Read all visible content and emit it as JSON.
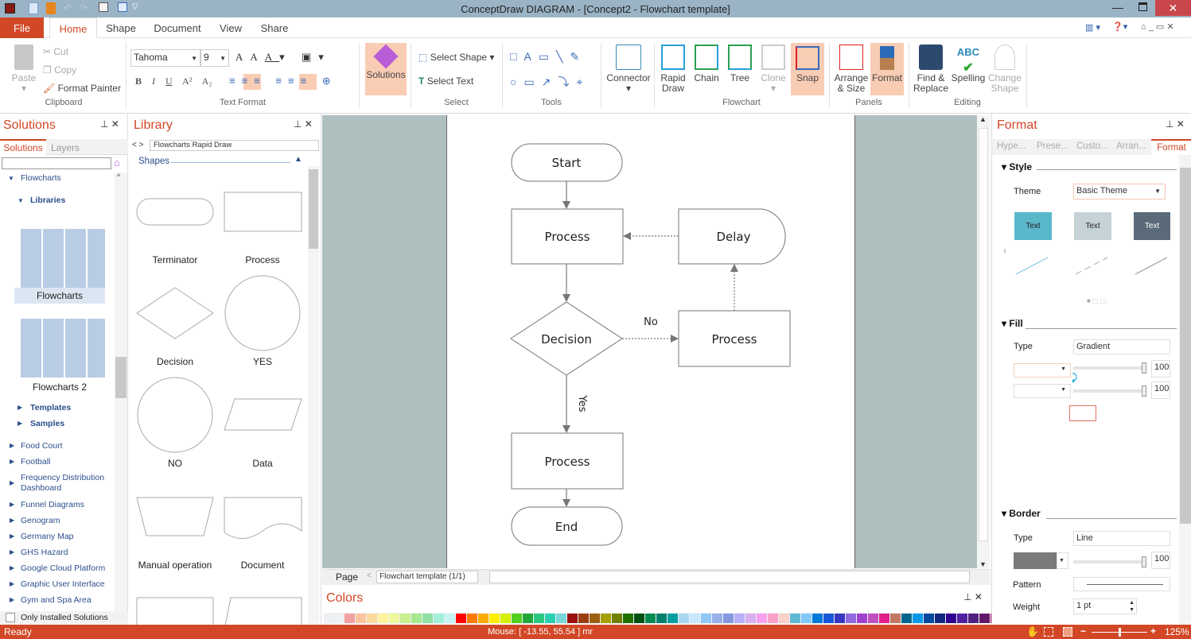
{
  "window": {
    "title": "ConceptDraw DIAGRAM - [Concept2 - Flowchart template]"
  },
  "tabs": {
    "file": "File",
    "items": [
      "Home",
      "Shape",
      "Document",
      "View",
      "Share"
    ]
  },
  "ribbon": {
    "clipboard": {
      "paste": "Paste",
      "cut": "Cut",
      "copy": "Copy",
      "format_painter": "Format Painter",
      "label": "Clipboard"
    },
    "text_format": {
      "font": "Tahoma",
      "size": "9",
      "label": "Text Format"
    },
    "solutions": {
      "label": "Solutions"
    },
    "select": {
      "select_shape": "Select Shape",
      "select_text": "Select Text",
      "label": "Select"
    },
    "tools": {
      "label": "Tools"
    },
    "flowchart": {
      "connector": "Connector",
      "rapid_draw": "Rapid Draw",
      "chain": "Chain",
      "tree": "Tree",
      "clone": "Clone",
      "snap": "Snap",
      "label": "Flowchart"
    },
    "panels": {
      "arrange": "Arrange & Size",
      "format": "Format",
      "label": "Panels"
    },
    "editing": {
      "find": "Find & Replace",
      "spelling": "Spelling",
      "change_shape": "Change Shape",
      "label": "Editing"
    }
  },
  "solutions_panel": {
    "title": "Solutions",
    "tabs": [
      "Solutions",
      "Layers"
    ],
    "search_value": "",
    "flowcharts": "Flowcharts",
    "libraries": "Libraries",
    "lib1": "Flowcharts",
    "lib2": "Flowcharts 2",
    "templates": "Templates",
    "samples": "Samples",
    "items": [
      "Food Court",
      "Football",
      "Frequency Distribution Dashboard",
      "Funnel Diagrams",
      "Genogram",
      "Germany Map",
      "GHS Hazard",
      "Google Cloud Platform",
      "Graphic User Interface",
      "Gym and Spa Area"
    ],
    "only_installed": "Only Installed Solutions"
  },
  "library_panel": {
    "title": "Library",
    "selected": "Flowcharts Rapid Draw",
    "section": "Shapes",
    "shapes": [
      "Terminator",
      "Process",
      "Decision",
      "YES",
      "NO",
      "Data",
      "Manual operation",
      "Document"
    ]
  },
  "canvas": {
    "nodes": {
      "start": "Start",
      "process1": "Process",
      "delay": "Delay",
      "decision": "Decision",
      "process2": "Process",
      "process3": "Process",
      "end": "End"
    },
    "labels": {
      "no": "No",
      "yes": "Yes"
    },
    "page_label": "Page",
    "page_select": "Flowchart template (1/1)"
  },
  "colors_panel": {
    "title": "Colors",
    "swatches": [
      "#f4a0a0",
      "#fbc59e",
      "#fdd99b",
      "#fdf39b",
      "#eef79b",
      "#c9ef8e",
      "#a6e88e",
      "#92e0a6",
      "#a2f0d8",
      "#c5f3f5",
      "#ff0000",
      "#ff7a00",
      "#ffaa00",
      "#ffee00",
      "#d6ee00",
      "#50d020",
      "#22a83a",
      "#2ac880",
      "#2ad0b0",
      "#78d8d8",
      "#9a1010",
      "#9a4010",
      "#9a6010",
      "#a8a000",
      "#708000",
      "#207000",
      "#005010",
      "#008a50",
      "#00806a",
      "#00a0a0",
      "#a8d8f0",
      "#c8e8ff",
      "#90c8f8",
      "#98b0e8",
      "#8898e0",
      "#b8b0f8",
      "#d8b0f0",
      "#f8a0f0",
      "#f8a0c8",
      "#f8d0c8",
      "#60b8d0",
      "#80c8f8",
      "#0078d8",
      "#1858d8",
      "#3838c0",
      "#9068e0",
      "#a040d0",
      "#c050c0",
      "#e02088",
      "#c07860",
      "#006890",
      "#0898e8",
      "#0048a0",
      "#102880",
      "#300090",
      "#5020a0",
      "#502080",
      "#601868",
      "#980060"
    ]
  },
  "format_panel": {
    "title": "Format",
    "tabs": [
      "Hype...",
      "Prese...",
      "Custo...",
      "Arran...",
      "Format"
    ],
    "style": {
      "heading": "Style",
      "theme_label": "Theme",
      "theme_value": "Basic Theme",
      "preview_text": "Text"
    },
    "fill": {
      "heading": "Fill",
      "type_label": "Type",
      "type_value": "Gradient",
      "opacity1": "100%",
      "opacity2": "100%"
    },
    "border": {
      "heading": "Border",
      "type_label": "Type",
      "type_value": "Line",
      "opacity": "100%",
      "pattern_label": "Pattern",
      "weight_label": "Weight",
      "weight_value": "1 pt"
    }
  },
  "status": {
    "ready": "Ready",
    "mouse": "Mouse: [ -13.55, 55.54 ] mr",
    "zoom": "125%"
  }
}
